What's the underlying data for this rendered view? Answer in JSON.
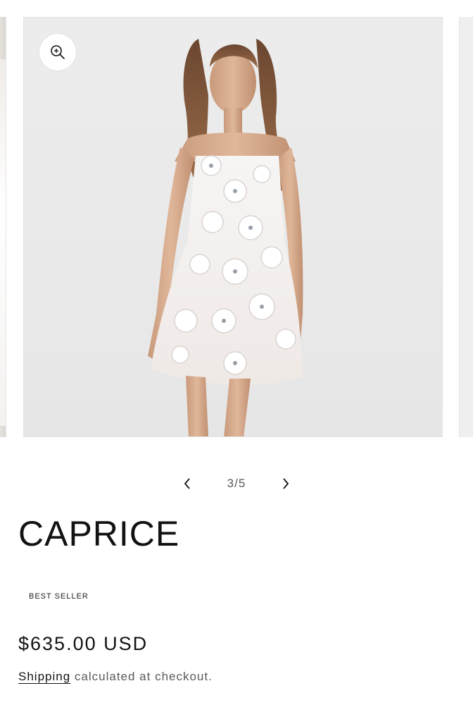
{
  "gallery": {
    "zoom_icon": "zoom-in-icon",
    "pager": {
      "prev_icon": "chevron-left-icon",
      "next_icon": "chevron-right-icon",
      "counter": "3/5"
    }
  },
  "product": {
    "title": "CAPRICE",
    "badge": "BEST SELLER",
    "price": "$635.00 USD",
    "shipping_link": "Shipping",
    "shipping_note": " calculated at checkout."
  }
}
